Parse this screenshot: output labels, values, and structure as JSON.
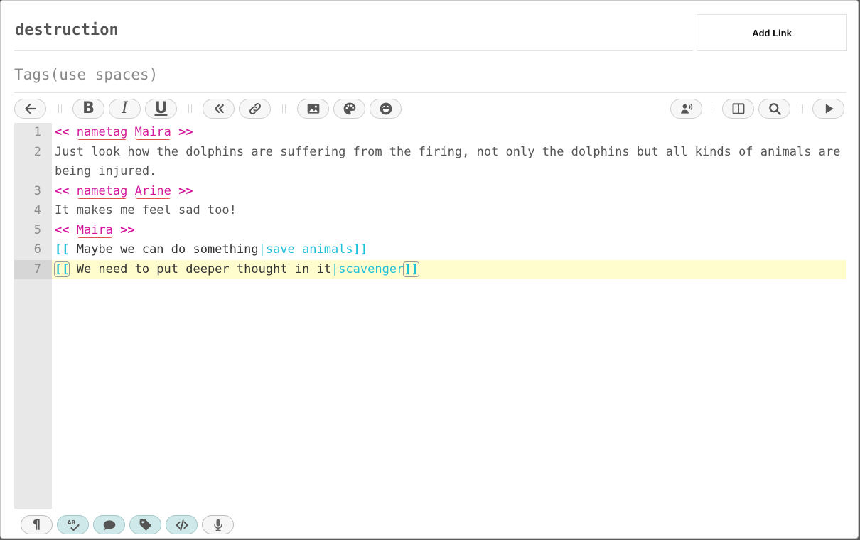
{
  "passage": {
    "title": "destruction"
  },
  "add_link_label": "Add Link",
  "tags": {
    "placeholder": "Tags(use spaces)",
    "value": ""
  },
  "toolbar": {
    "icons": [
      "back-arrow-icon",
      "bold-icon",
      "italic-icon",
      "underline-icon",
      "double-chevron-left-icon",
      "link-icon",
      "image-icon",
      "palette-icon",
      "emoji-icon",
      "speaker-icon",
      "split-view-icon",
      "search-icon",
      "play-icon"
    ],
    "bold_label": "B",
    "italic_label": "I",
    "underline_label": "U"
  },
  "editor": {
    "active_line": 7,
    "lines": [
      {
        "n": "1",
        "open": "<<",
        "words": [
          "nametag",
          "Maira"
        ],
        "close": ">>"
      },
      {
        "n": "2",
        "text": "Just look how the dolphins are suffering from the firing, not only the dolphins but all kinds of animals are being injured."
      },
      {
        "n": "3",
        "open": "<<",
        "words": [
          "nametag",
          "Arine"
        ],
        "close": ">>"
      },
      {
        "n": "4",
        "text": "It makes me feel sad too!"
      },
      {
        "n": "5",
        "open": "<<",
        "words": [
          "Maira"
        ],
        "close": ">>"
      },
      {
        "n": "6",
        "link_open": "[[",
        "link_text": " Maybe we can do something",
        "link_target": "|save animals",
        "link_close": "]]"
      },
      {
        "n": "7",
        "link_open": "[[",
        "link_text": " We need to put deeper thought in it",
        "link_target": "|scavenger",
        "link_close": "]]"
      }
    ]
  },
  "bottom_toolbar": {
    "buttons": [
      {
        "icon": "pilcrow-icon",
        "active": false
      },
      {
        "icon": "spellcheck-icon",
        "active": true
      },
      {
        "icon": "comment-icon",
        "active": true
      },
      {
        "icon": "tag-icon",
        "active": true
      },
      {
        "icon": "code-icon",
        "active": true
      },
      {
        "icon": "microphone-icon",
        "active": false
      }
    ],
    "pilcrow_label": "¶",
    "spellcheck_label": "AB"
  },
  "colors": {
    "macro": "#d4199e",
    "link": "#1fc0d8",
    "active_line_bg": "#fffdce",
    "gutter_bg": "#e8e8e8",
    "toggle_on_bg": "#cfe9ea"
  }
}
